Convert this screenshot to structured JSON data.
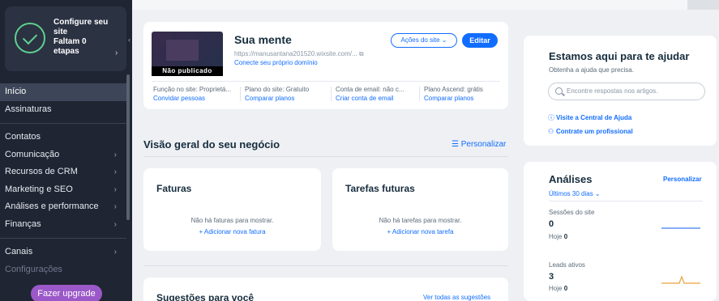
{
  "sidebar": {
    "setup": {
      "line1": "Configure seu",
      "line2": "site",
      "line3": "Faltam 0",
      "line4": "etapas"
    },
    "items": [
      {
        "label": "Início",
        "chevron": false
      },
      {
        "label": "Assinaturas",
        "chevron": false
      },
      {
        "label": "Contatos",
        "chevron": false
      },
      {
        "label": "Comunicação",
        "chevron": true
      },
      {
        "label": "Recursos de CRM",
        "chevron": true
      },
      {
        "label": "Marketing e SEO",
        "chevron": true
      },
      {
        "label": "Análises e performance",
        "chevron": true
      },
      {
        "label": "Finanças",
        "chevron": true
      },
      {
        "label": "Canais",
        "chevron": true
      },
      {
        "label": "Configurações",
        "chevron": false
      }
    ],
    "upgrade_label": "Fazer upgrade"
  },
  "site": {
    "name": "Sua mente",
    "url": "https://manusantana201520.wixsite.com/...",
    "domain_link": "Conecte seu próprio domínio",
    "badge": "Não publicado",
    "actions_label": "Ações do site",
    "edit_label": "Editar",
    "info": [
      {
        "key": "Função no site: Proprietá...",
        "link": "Convidar pessoas"
      },
      {
        "key": "Plano do site: Gratuito",
        "link": "Comparar planos"
      },
      {
        "key": "Conta de email: não c...",
        "link": "Criar conta de email"
      },
      {
        "key": "Plano Ascend: grátis",
        "link": "Comparar planos"
      }
    ]
  },
  "overview": {
    "title": "Visão geral do seu negócio",
    "personalize": "Personalizar",
    "invoices": {
      "title": "Faturas",
      "empty": "Não há faturas para mostrar.",
      "add": "+ Adicionar nova fatura"
    },
    "tasks": {
      "title": "Tarefas futuras",
      "empty": "Não há tarefas para mostrar.",
      "add": "+ Adicionar nova tarefa"
    }
  },
  "suggestions": {
    "title": "Sugestões para você",
    "link": "Ver todas as sugestões"
  },
  "help": {
    "title": "Estamos aqui para te ajudar",
    "subtitle": "Obtenha a ajuda que precisa.",
    "search_placeholder": "Encontre respostas nos artigos.",
    "link1": "Visite a Central de Ajuda",
    "link2": "Contrate um profissional"
  },
  "analytics": {
    "title": "Análises",
    "personalize": "Personalizar",
    "range": "Últimos 30 dias",
    "sessions": {
      "label": "Sessões do site",
      "value": "0",
      "today_label": "Hoje",
      "today_value": "0"
    },
    "leads": {
      "label": "Leads ativos",
      "value": "3",
      "today_label": "Hoje",
      "today_value": "0"
    }
  },
  "colors": {
    "accent": "#116dff",
    "sidebar": "#1f2533",
    "upgrade": "#9b58c8",
    "success": "#5fcf8f",
    "spark_line": "#3f7cf0",
    "spark_alt": "#e8a33a"
  }
}
